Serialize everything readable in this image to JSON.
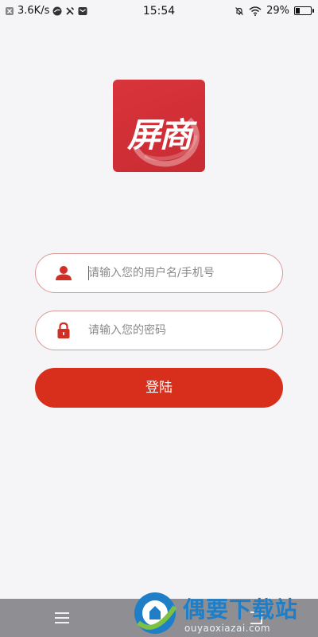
{
  "status_bar": {
    "network_speed": "3.6K/s",
    "time": "15:54",
    "battery_percent": "29%",
    "battery_level": 0.29
  },
  "logo": {
    "text": "屏商",
    "background_color": "#d32f36"
  },
  "login_form": {
    "username_placeholder": "请输入您的用户名/手机号",
    "username_value": "",
    "password_placeholder": "请输入您的密码",
    "password_value": "",
    "login_label": "登陆"
  },
  "colors": {
    "accent": "#d82f1c",
    "input_border": "#d99a95",
    "icon": "#d12e26",
    "page_background": "#f5f4f7",
    "nav_bar": "#8f8f93"
  },
  "icons": {
    "username": "user-icon",
    "password": "lock-icon",
    "nav_menu": "menu-icon",
    "nav_home": "home-icon",
    "nav_back": "back-icon"
  },
  "watermark": {
    "title": "偶要下载站",
    "subtitle": "ouyaoxiazai.com"
  }
}
